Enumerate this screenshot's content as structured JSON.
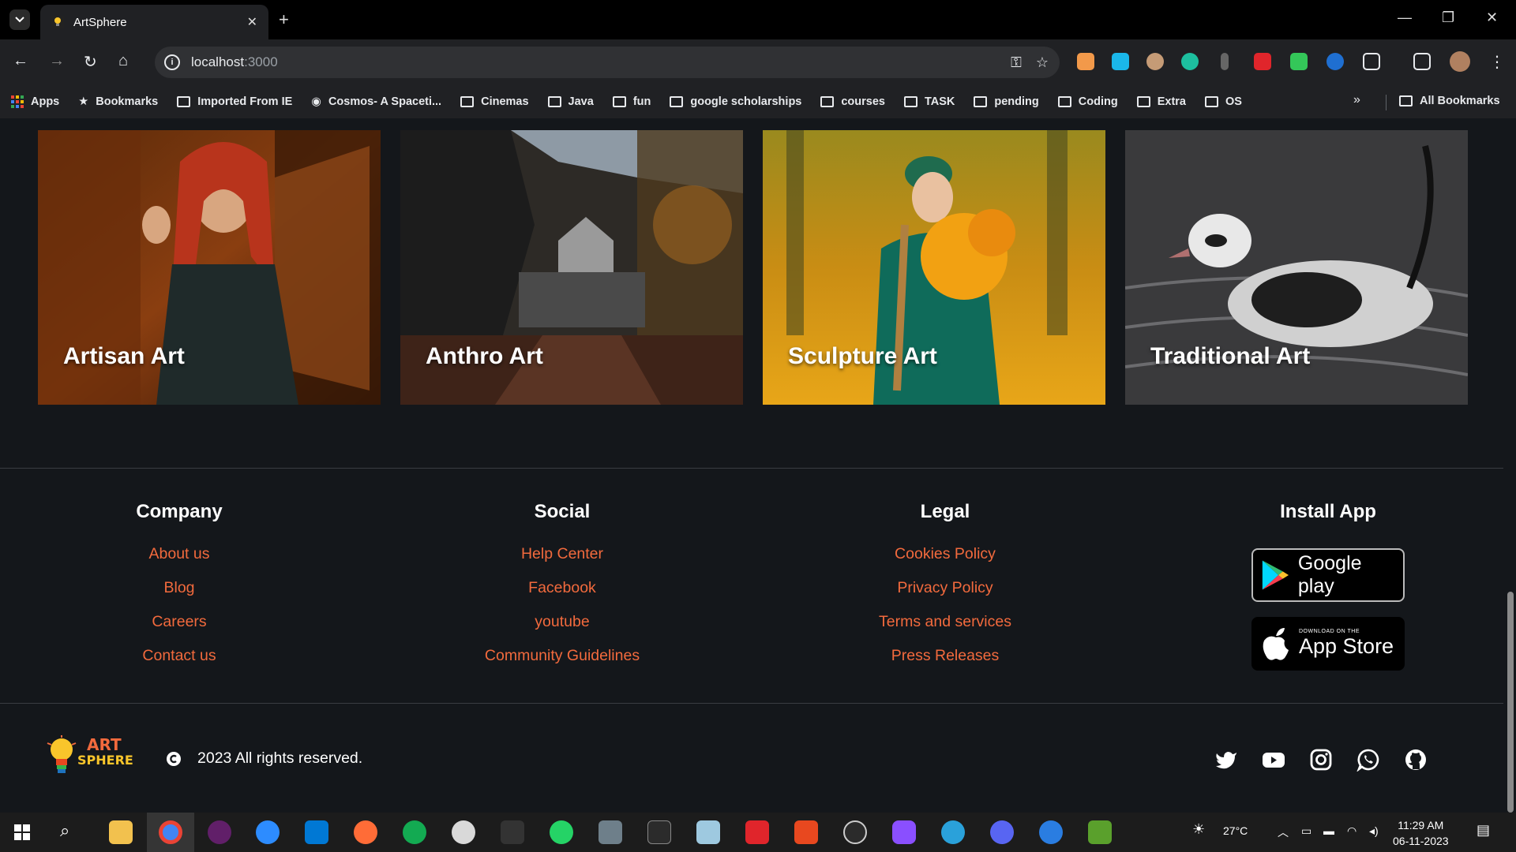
{
  "browser": {
    "tab_title": "ArtSphere",
    "url_host": "localhost",
    "url_port": ":3000",
    "bookmarks": [
      {
        "label": "Apps",
        "icon": "apps-grid-icon"
      },
      {
        "label": "Bookmarks",
        "icon": "star-icon"
      },
      {
        "label": "Imported From IE",
        "icon": "folder-icon"
      },
      {
        "label": "Cosmos- A Spaceti...",
        "icon": "globe-icon"
      },
      {
        "label": "Cinemas",
        "icon": "folder-icon"
      },
      {
        "label": "Java",
        "icon": "folder-icon"
      },
      {
        "label": "fun",
        "icon": "folder-icon"
      },
      {
        "label": "google scholarships",
        "icon": "folder-icon"
      },
      {
        "label": "courses",
        "icon": "folder-icon"
      },
      {
        "label": "TASK",
        "icon": "folder-icon"
      },
      {
        "label": "pending",
        "icon": "folder-icon"
      },
      {
        "label": "Coding",
        "icon": "folder-icon"
      },
      {
        "label": "Extra",
        "icon": "folder-icon"
      },
      {
        "label": "OS",
        "icon": "folder-icon"
      }
    ],
    "all_bookmarks": "All Bookmarks"
  },
  "cards": [
    {
      "label": "Artisan Art"
    },
    {
      "label": "Anthro Art"
    },
    {
      "label": "Sculpture Art"
    },
    {
      "label": "Traditional Art"
    }
  ],
  "footer": {
    "columns": [
      {
        "heading": "Company",
        "links": [
          "About us",
          "Blog",
          "Careers",
          "Contact us"
        ]
      },
      {
        "heading": "Social",
        "links": [
          "Help Center",
          "Facebook",
          "youtube",
          "Community Guidelines"
        ]
      },
      {
        "heading": "Legal",
        "links": [
          "Cookies Policy",
          "Privacy Policy",
          "Terms and services",
          "Press Releases"
        ]
      },
      {
        "heading": "Install App",
        "links": []
      }
    ],
    "google_play": "Google play",
    "app_store_small": "DOWNLOAD ON THE",
    "app_store": "App Store",
    "logo_top": "ART",
    "logo_bottom": "SPHERE",
    "copyright": "2023 All rights reserved.",
    "social_icons": [
      "twitter-icon",
      "youtube-icon",
      "instagram-icon",
      "whatsapp-icon",
      "github-icon"
    ],
    "link_color": "#f26a3d"
  },
  "taskbar": {
    "weather": "27°C",
    "time": "11:29 AM",
    "date": "06-11-2023"
  }
}
